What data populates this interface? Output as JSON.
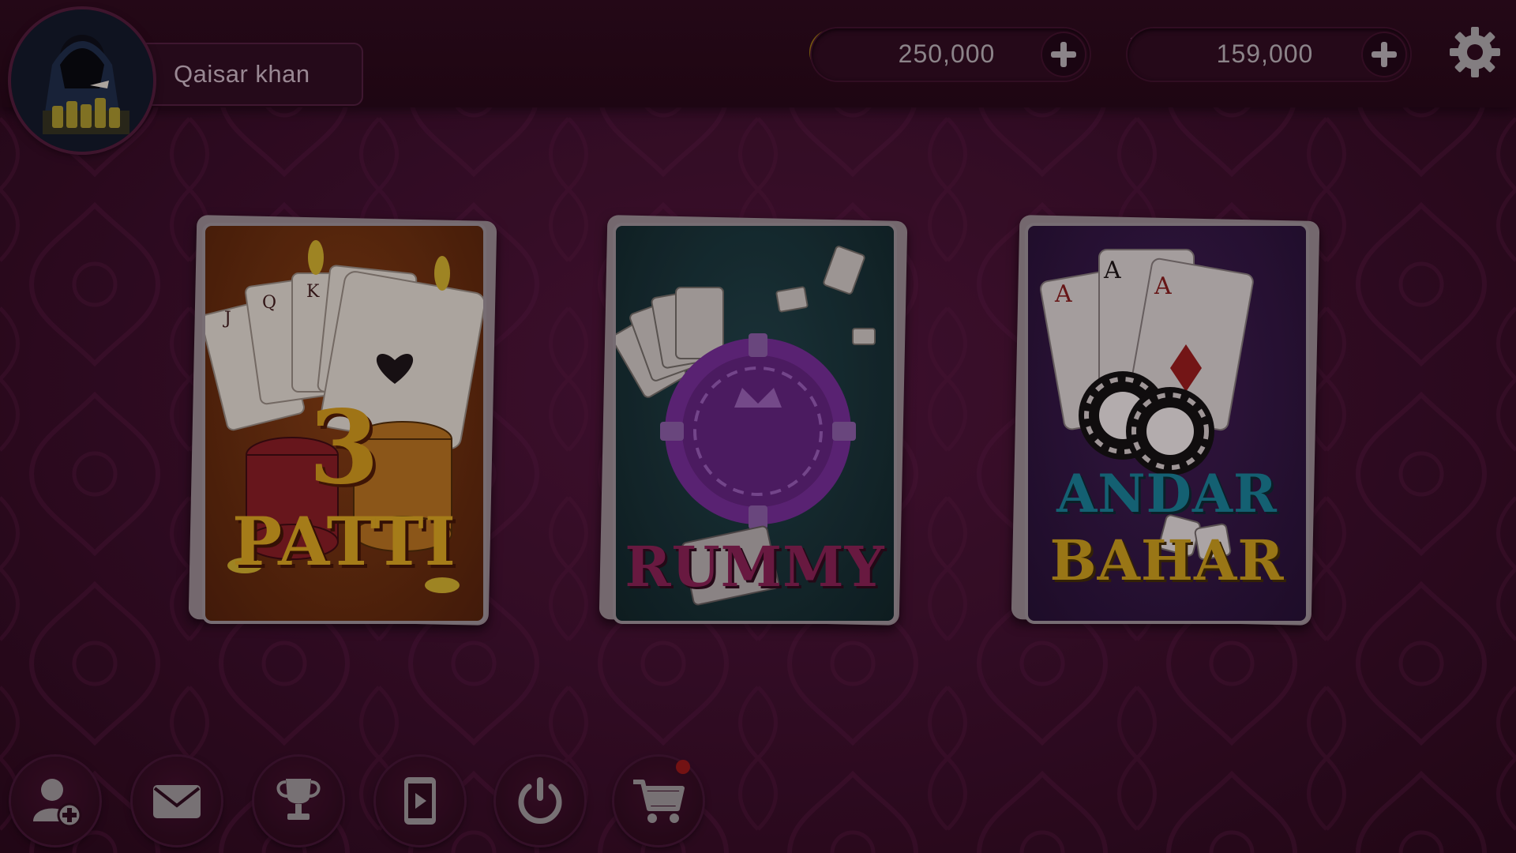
{
  "player": {
    "name": "Qaisar khan"
  },
  "wallet": {
    "coins": "250,000",
    "chips": "159,000"
  },
  "games": [
    {
      "title_line1": "3",
      "title_line2": "PATTI"
    },
    {
      "title_line1": "RUMMY"
    },
    {
      "title_line1": "ANDAR",
      "title_line2": "BAHAR"
    }
  ],
  "bottom_bar": [
    {
      "icon": "add-friend-icon"
    },
    {
      "icon": "mail-icon"
    },
    {
      "icon": "trophy-icon"
    },
    {
      "icon": "video-icon"
    },
    {
      "icon": "power-icon"
    },
    {
      "icon": "cart-icon"
    }
  ],
  "colors": {
    "background": "#3a0f2b",
    "gold": "#d4a11e",
    "text": "#b9a6b2"
  }
}
